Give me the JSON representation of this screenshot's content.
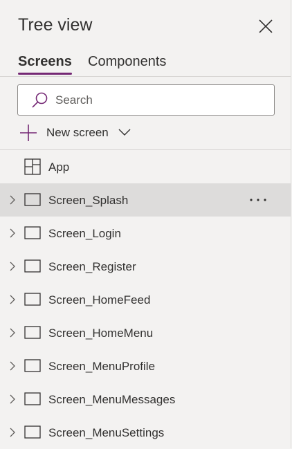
{
  "header": {
    "title": "Tree view"
  },
  "tabs": [
    {
      "label": "Screens",
      "active": true
    },
    {
      "label": "Components",
      "active": false
    }
  ],
  "search": {
    "placeholder": "Search",
    "value": ""
  },
  "new_screen": {
    "label": "New screen"
  },
  "app": {
    "label": "App",
    "icon": "app-icon"
  },
  "screens": [
    {
      "label": "Screen_Splash",
      "selected": true
    },
    {
      "label": "Screen_Login",
      "selected": false
    },
    {
      "label": "Screen_Register",
      "selected": false
    },
    {
      "label": "Screen_HomeFeed",
      "selected": false
    },
    {
      "label": "Screen_HomeMenu",
      "selected": false
    },
    {
      "label": "Screen_MenuProfile",
      "selected": false
    },
    {
      "label": "Screen_MenuMessages",
      "selected": false
    },
    {
      "label": "Screen_MenuSettings",
      "selected": false
    }
  ],
  "colors": {
    "accent": "#742774",
    "selected_row": "#dddcdb",
    "panel_bg": "#f3f2f1"
  }
}
